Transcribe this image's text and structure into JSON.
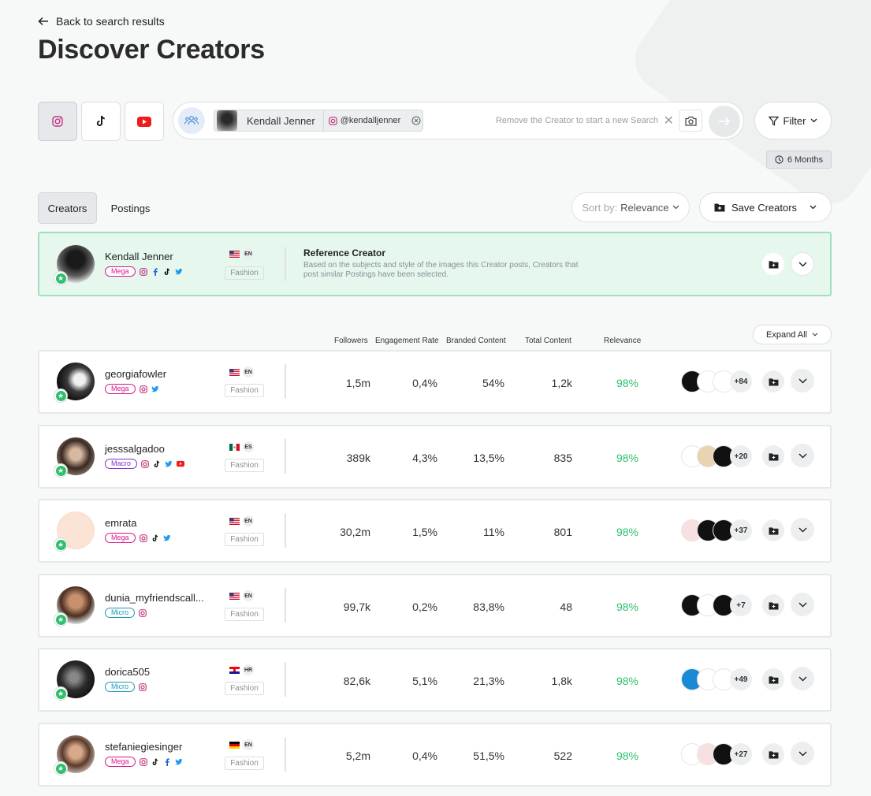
{
  "back_label": "Back to search results",
  "page_title": "Discover Creators",
  "search": {
    "chip_name": "Kendall Jenner",
    "chip_handle": "@kendalljenner",
    "hint": "Remove the Creator to start a new Search"
  },
  "filter_label": "Filter",
  "period_label": "6 Months",
  "tabs": [
    "Creators",
    "Postings"
  ],
  "sort": {
    "prefix": "Sort by:",
    "value": "Relevance"
  },
  "save_label": "Save Creators",
  "reference": {
    "name": "Kendall Jenner",
    "tier": "Mega",
    "lang": "EN",
    "category": "Fashion",
    "title": "Reference Creator",
    "description": "Based on the subjects and style of the images this Creator posts, Creators that post similar Postings have been selected."
  },
  "columns": [
    "Followers",
    "Engagement Rate",
    "Branded Content",
    "Total Content",
    "Relevance"
  ],
  "expand_label": "Expand All",
  "colors": {
    "accent": "#2fbf6e",
    "mega": "#d6188a",
    "macro": "#7a33c7",
    "micro": "#1d98b5"
  },
  "creators": [
    {
      "name": "georgiafowler",
      "tier": "Mega",
      "socials": [
        "instagram-icon",
        "twitter-icon"
      ],
      "flag": "US",
      "lang": "EN",
      "category": "Fashion",
      "followers": "1,5m",
      "engagement": "0,4%",
      "branded": "54%",
      "total": "1,2k",
      "relevance": "98%",
      "more_brands": "+84"
    },
    {
      "name": "jesssalgadoo",
      "tier": "Macro",
      "socials": [
        "instagram-icon",
        "tiktok-icon",
        "twitter-icon",
        "youtube-icon"
      ],
      "flag": "MX",
      "lang": "ES",
      "category": "Fashion",
      "followers": "389k",
      "engagement": "4,3%",
      "branded": "13,5%",
      "total": "835",
      "relevance": "98%",
      "more_brands": "+20"
    },
    {
      "name": "emrata",
      "tier": "Mega",
      "socials": [
        "instagram-icon",
        "tiktok-icon",
        "twitter-icon"
      ],
      "flag": "US",
      "lang": "EN",
      "category": "Fashion",
      "followers": "30,2m",
      "engagement": "1,5%",
      "branded": "11%",
      "total": "801",
      "relevance": "98%",
      "more_brands": "+37"
    },
    {
      "name": "dunia_myfriendscall...",
      "tier": "Micro",
      "socials": [
        "instagram-icon"
      ],
      "flag": "US",
      "lang": "EN",
      "category": "Fashion",
      "followers": "99,7k",
      "engagement": "0,2%",
      "branded": "83,8%",
      "total": "48",
      "relevance": "98%",
      "more_brands": "+7"
    },
    {
      "name": "dorica505",
      "tier": "Micro",
      "socials": [
        "instagram-icon"
      ],
      "flag": "HR",
      "lang": "HR",
      "category": "Fashion",
      "followers": "82,6k",
      "engagement": "5,1%",
      "branded": "21,3%",
      "total": "1,8k",
      "relevance": "98%",
      "more_brands": "+49"
    },
    {
      "name": "stefaniegiesinger",
      "tier": "Mega",
      "socials": [
        "instagram-icon",
        "tiktok-icon",
        "facebook-icon",
        "twitter-icon"
      ],
      "flag": "DE",
      "lang": "EN",
      "category": "Fashion",
      "followers": "5,2m",
      "engagement": "0,4%",
      "branded": "51,5%",
      "total": "522",
      "relevance": "98%",
      "more_brands": "+27"
    }
  ]
}
